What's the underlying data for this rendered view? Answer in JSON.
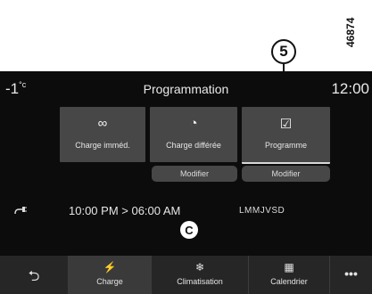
{
  "figure_ref": "46874",
  "callouts": {
    "five": "5",
    "c": "C"
  },
  "header": {
    "temperature": "-1",
    "temperature_unit": "°c",
    "title": "Programmation",
    "clock": "12:00"
  },
  "modes": [
    {
      "icon": "∞",
      "label": "Charge imméd."
    },
    {
      "icon": "◔",
      "label": "Charge différée"
    },
    {
      "icon": "☑",
      "label": "Programme",
      "selected": true
    }
  ],
  "modify_buttons": [
    "Modifier",
    "Modifier"
  ],
  "schedule": {
    "icon": "plug-icon",
    "time_range": "10:00 PM > 06:00 AM",
    "days": "LMMJVSD"
  },
  "nav": {
    "back_icon": "⮌",
    "items": [
      {
        "icon": "⚡",
        "label": "Charge",
        "active": true
      },
      {
        "icon": "❄",
        "label": "Climatisation"
      },
      {
        "icon": "▦",
        "label": "Calendrier"
      }
    ],
    "more_icon": "•••"
  }
}
